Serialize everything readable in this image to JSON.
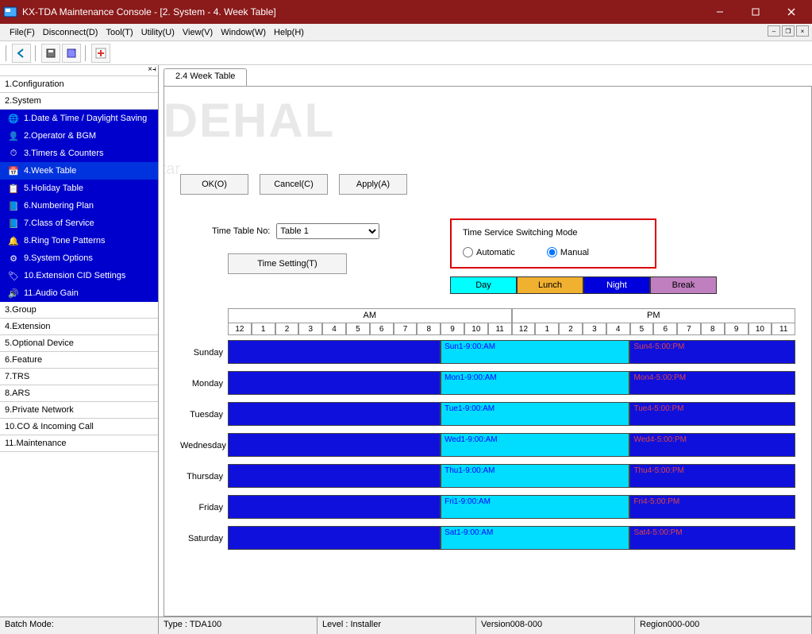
{
  "window": {
    "title": "KX-TDA Maintenance Console - [2. System - 4. Week Table]"
  },
  "menu": {
    "file": "File(F)",
    "disconnect": "Disconnect(D)",
    "tool": "Tool(T)",
    "utility": "Utility(U)",
    "view": "View(V)",
    "window": "Window(W)",
    "help": "Help(H)"
  },
  "nav": {
    "items": [
      "1.Configuration",
      "2.System",
      "3.Group",
      "4.Extension",
      "5.Optional Device",
      "6.Feature",
      "7.TRS",
      "8.ARS",
      "9.Private Network",
      "10.CO & Incoming Call",
      "11.Maintenance"
    ],
    "system_subs": [
      "1.Date & Time / Daylight Saving",
      "2.Operator & BGM",
      "3.Timers & Counters",
      "4.Week Table",
      "5.Holiday Table",
      "6.Numbering Plan",
      "7.Class of Service",
      "8.Ring Tone Patterns",
      "9.System Options",
      "10.Extension CID Settings",
      "11.Audio Gain"
    ]
  },
  "tab": {
    "label": "2.4 Week Table"
  },
  "buttons": {
    "ok": "OK(O)",
    "cancel": "Cancel(C)",
    "apply": "Apply(A)",
    "time_setting": "Time Setting(T)"
  },
  "form": {
    "timetable_label": "Time Table No:",
    "timetable_value": "Table 1"
  },
  "mode": {
    "title": "Time Service Switching Mode",
    "auto": "Automatic",
    "manual": "Manual",
    "selected": "Manual",
    "day": "Day",
    "lunch": "Lunch",
    "night": "Night",
    "break": "Break"
  },
  "hours": {
    "am_label": "AM",
    "pm_label": "PM",
    "am": [
      "12",
      "1",
      "2",
      "3",
      "4",
      "5",
      "6",
      "7",
      "8",
      "9",
      "10",
      "11"
    ],
    "pm": [
      "12",
      "1",
      "2",
      "3",
      "4",
      "5",
      "6",
      "7",
      "8",
      "9",
      "10",
      "11"
    ]
  },
  "days": [
    "Sunday",
    "Monday",
    "Tuesday",
    "Wednesday",
    "Thursday",
    "Friday",
    "Saturday"
  ],
  "schedule": [
    {
      "am": "Sun1-9:00:AM",
      "pm": "Sun4-5:00:PM"
    },
    {
      "am": "Mon1-9:00:AM",
      "pm": "Mon4-5:00:PM"
    },
    {
      "am": "Tue1-9:00:AM",
      "pm": "Tue4-5:00:PM"
    },
    {
      "am": "Wed1-9:00:AM",
      "pm": "Wed4-5:00:PM"
    },
    {
      "am": "Thu1-9:00:AM",
      "pm": "Thu4-5:00:PM"
    },
    {
      "am": "Fri1-9:00:AM",
      "pm": "Fri4-5:00:PM"
    },
    {
      "am": "Sat1-9:00:AM",
      "pm": "Sat4-5:00:PM"
    }
  ],
  "status": {
    "batch": "Batch Mode:",
    "type": "Type : TDA100",
    "level": "Level : Installer",
    "version": "Version008-000",
    "region": "Region000-000"
  },
  "watermark": {
    "main": "iDEHAL",
    "sub": "Gostar"
  }
}
